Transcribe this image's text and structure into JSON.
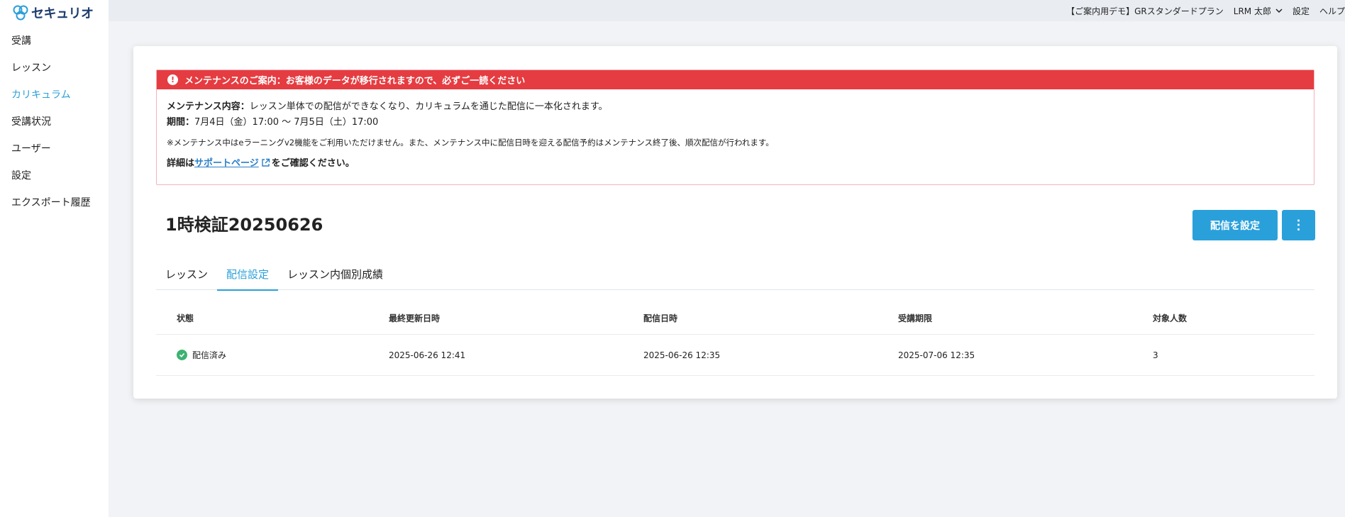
{
  "sidebar": {
    "logo_text": "セキュリオ",
    "items": [
      {
        "label": "受講"
      },
      {
        "label": "レッスン"
      },
      {
        "label": "カリキュラム",
        "active": true
      },
      {
        "label": "受講状況"
      },
      {
        "label": "ユーザー"
      },
      {
        "label": "設定"
      },
      {
        "label": "エクスポート履歴"
      }
    ]
  },
  "topbar": {
    "plan": "【ご案内用デモ】GRスタンダードプラン",
    "user": "LRM 太郎",
    "settings": "設定",
    "help": "ヘルプ"
  },
  "notice": {
    "title": "メンテナンスのご案内：お客様のデータが移行されますので、必ずご一読ください",
    "content_label": "メンテナンス内容：",
    "content_text": "レッスン単体での配信ができなくなり、カリキュラムを通じた配信に一本化されます。",
    "period_label": "期間：",
    "period_text": "7月4日（金）17:00 ～ 7月5日（土）17:00",
    "note": "※メンテナンス中はeラーニングv2機能をご利用いただけません。また、メンテナンス中に配信日時を迎える配信予約はメンテナンス終了後、順次配信が行われます。",
    "detail_prefix": "詳細は",
    "detail_link": "サポートページ",
    "detail_suffix": "をご確認ください。"
  },
  "page": {
    "title": "1時検証20250626",
    "primary_button": "配信を設定",
    "more_button": "⋮"
  },
  "tabs": [
    {
      "label": "レッスン"
    },
    {
      "label": "配信設定",
      "active": true
    },
    {
      "label": "レッスン内個別成績"
    }
  ],
  "table": {
    "headers": [
      "状態",
      "最終更新日時",
      "配信日時",
      "受講期限",
      "対象人数"
    ],
    "rows": [
      {
        "status": "配信済み",
        "updated": "2025-06-26 12:41",
        "delivered": "2025-06-26 12:35",
        "deadline": "2025-07-06 12:35",
        "count": "3"
      }
    ]
  },
  "colors": {
    "accent": "#2aa0db",
    "danger": "#e53c41",
    "success": "#3cb371"
  }
}
